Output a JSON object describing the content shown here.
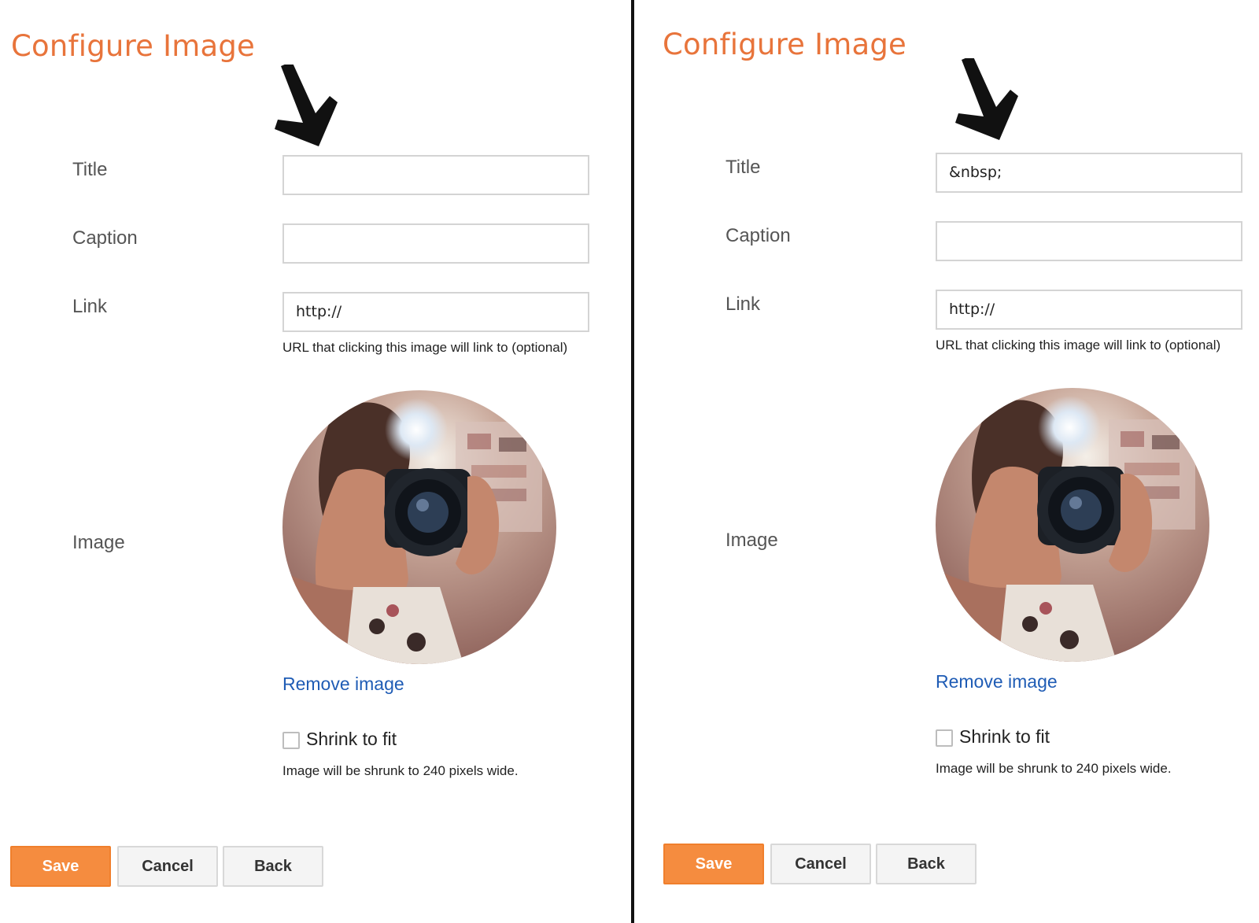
{
  "colors": {
    "title": "#e8743b",
    "link": "#1f5cb5",
    "save_button": "#f58c3f",
    "divider": "#111111"
  },
  "icons": {
    "arrow": "arrow-down-right-icon",
    "checkbox": "checkbox-unchecked-icon"
  },
  "left": {
    "title": "Configure Image",
    "labels": {
      "title": "Title",
      "caption": "Caption",
      "link": "Link",
      "image": "Image"
    },
    "fields": {
      "title_value": "",
      "caption_value": "",
      "link_value": "http://"
    },
    "link_help": "URL that clicking this image will link to (optional)",
    "remove_image": "Remove image",
    "shrink": {
      "label": "Shrink to fit",
      "checked": false,
      "help": "Image will be shrunk to 240 pixels wide."
    },
    "buttons": {
      "save": "Save",
      "cancel": "Cancel",
      "back": "Back"
    }
  },
  "right": {
    "title": "Configure Image",
    "labels": {
      "title": "Title",
      "caption": "Caption",
      "link": "Link",
      "image": "Image"
    },
    "fields": {
      "title_value": "&nbsp;",
      "caption_value": "",
      "link_value": "http://"
    },
    "link_help": "URL that clicking this image will link to (optional)",
    "remove_image": "Remove image",
    "shrink": {
      "label": "Shrink to fit",
      "checked": false,
      "help": "Image will be shrunk to 240 pixels wide."
    },
    "buttons": {
      "save": "Save",
      "cancel": "Cancel",
      "back": "Back"
    }
  }
}
